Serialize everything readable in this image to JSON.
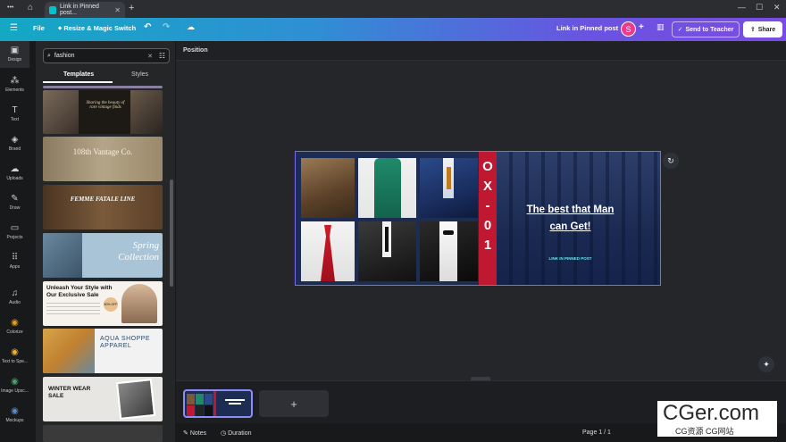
{
  "browser": {
    "tab_title": "Link in Pinned post...",
    "new_tab": "+",
    "menu_dots": "•••",
    "win_min": "—",
    "win_max": "☐",
    "win_close": "✕"
  },
  "header": {
    "file_label": "File",
    "resize_label": "Resize & Magic Switch",
    "doc_title": "Link in Pinned post",
    "avatar_initial": "S",
    "send_teacher_label": "Send to Teacher",
    "share_label": "Share"
  },
  "rail": {
    "items": [
      {
        "label": "Design",
        "icon": "▣"
      },
      {
        "label": "Elements",
        "icon": "⁂"
      },
      {
        "label": "Text",
        "icon": "T"
      },
      {
        "label": "Brand",
        "icon": "◈"
      },
      {
        "label": "Uploads",
        "icon": "☁"
      },
      {
        "label": "Draw",
        "icon": "✎"
      },
      {
        "label": "Projects",
        "icon": "▭"
      },
      {
        "label": "Apps",
        "icon": "⠿"
      },
      {
        "label": "Audio",
        "icon": "♫"
      },
      {
        "label": "Colorize",
        "icon": "◉"
      },
      {
        "label": "Text to Spe...",
        "icon": "◉"
      },
      {
        "label": "Image Upsc...",
        "icon": "◉"
      },
      {
        "label": "Mockups",
        "icon": "◉"
      }
    ]
  },
  "panel": {
    "search_value": "fashion",
    "tabs": [
      "Templates",
      "Styles"
    ],
    "templates": [
      {
        "text": "Sharing the beauty of rare vintage finds"
      },
      {
        "text": "108th Vantage Co."
      },
      {
        "text": "FEMME FATALE LINE"
      },
      {
        "text": "Spring Collection"
      },
      {
        "text": "Unleash Your Style with Our Exclusive Sale",
        "badge": "50% OFF"
      },
      {
        "text": "AQUA SHOPPE APPAREL"
      },
      {
        "text": "WINTER WEAR SALE"
      }
    ]
  },
  "canvas": {
    "position_label": "Position",
    "design": {
      "strip_text": [
        "O",
        "X",
        "-",
        "0",
        "1"
      ],
      "headline_line1": "The best that Man",
      "headline_line2": "can Get!",
      "pinned_label": "LINK IN PINNED POST"
    }
  },
  "pages": {
    "add_label": "+",
    "page_indicator": "Page 1 / 1"
  },
  "footer": {
    "notes_label": "Notes",
    "duration_label": "Duration"
  },
  "watermark": {
    "big": "CGer.com",
    "small": "CG资源 CG网站"
  },
  "colors": {
    "accent": "#7a6cf0",
    "design_bg": "#1c2c52",
    "strip_red": "#c01830",
    "avatar": "#ec3b8c"
  }
}
